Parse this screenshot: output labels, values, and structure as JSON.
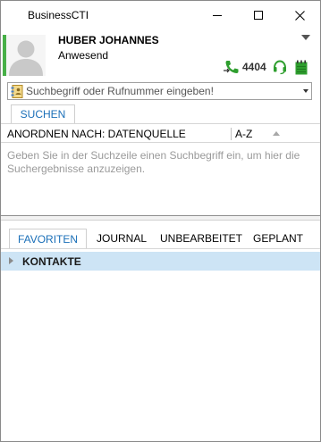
{
  "window": {
    "title": "BusinessCTI"
  },
  "profile": {
    "name": "HUBER JOHANNES",
    "status": "Anwesend",
    "extension": "4404",
    "presence_color": "#47b047"
  },
  "search": {
    "placeholder": "Suchbegriff oder Rufnummer eingeben!",
    "tab_label": "SUCHEN",
    "sort_label": "ANORDNEN NACH: DATENQUELLE",
    "sort_order": "A-Z",
    "hint": "Geben Sie in der Suchzeile einen Suchbegriff ein, um hier die Suchergebnisse anzuzeigen."
  },
  "tabs": [
    {
      "label": "FAVORITEN",
      "active": true
    },
    {
      "label": "JOURNAL",
      "active": false
    },
    {
      "label": "UNBEARBEITET",
      "active": false
    },
    {
      "label": "GEPLANT",
      "active": false
    }
  ],
  "favorites": {
    "groups": [
      {
        "label": "KONTAKTE"
      }
    ]
  },
  "colors": {
    "accent": "#1a6fb8",
    "icon_green": "#2e9e2e",
    "selection": "#cde4f5"
  }
}
